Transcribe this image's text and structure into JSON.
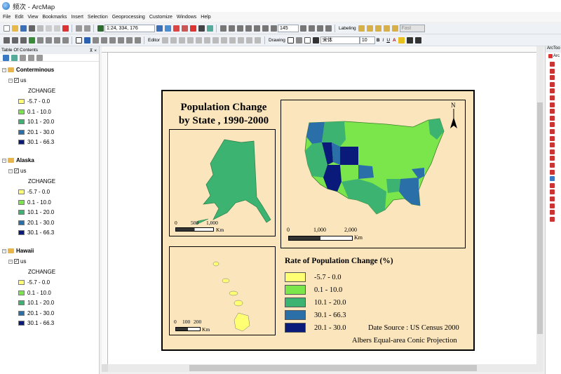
{
  "window": {
    "title": "频次 - ArcMap"
  },
  "menu": [
    "File",
    "Edit",
    "View",
    "Bookmarks",
    "Insert",
    "Selection",
    "Geoprocessing",
    "Customize",
    "Windows",
    "Help"
  ],
  "toolbar": {
    "scale": "1:24, 334, 176",
    "zoom": "145",
    "labeling": "Labeling",
    "fast": "Fast",
    "editor": "Editor",
    "drawing": "Drawing",
    "font": "宋体",
    "font_size": "10",
    "bold": "B",
    "italic": "I",
    "underline": "U",
    "font_color": "A"
  },
  "toc": {
    "title": "Table Of Contents",
    "pin": "⊼ ×",
    "groups": [
      {
        "frame": "Conterminous",
        "layer": "us",
        "field": "ZCHANGE"
      },
      {
        "frame": "Alaska",
        "layer": "us",
        "field": "ZCHANGE"
      },
      {
        "frame": "Hawaii",
        "layer": "us",
        "field": "ZCHANGE"
      }
    ],
    "classes": [
      {
        "label": "-5.7 - 0.0",
        "color": "#ffff73"
      },
      {
        "label": "0.1 - 10.0",
        "color": "#7ae64b"
      },
      {
        "label": "10.1 - 20.0",
        "color": "#3cb371"
      },
      {
        "label": "20.1 - 30.0",
        "color": "#2a6fa8"
      },
      {
        "label": "30.1 - 66.3",
        "color": "#0a1a7a"
      }
    ]
  },
  "right_panel": {
    "title": "ArcToo",
    "item": "Arc"
  },
  "map": {
    "title_line1": "Population Change",
    "title_line2": "by State , 1990-2000",
    "north": "N",
    "alaska_scale": {
      "labels": [
        "0",
        "500",
        "1,000"
      ],
      "unit": "Km"
    },
    "conus_scale": {
      "labels": [
        "0",
        "1,000",
        "2,000"
      ],
      "unit": "Km"
    },
    "hawaii_scale": {
      "labels": [
        "0",
        "100",
        "200"
      ],
      "unit": "Km"
    },
    "legend_title": "Rate of Population Change (%)",
    "legend": [
      {
        "label": "-5.7 - 0.0",
        "color": "#ffff73"
      },
      {
        "label": "0.1 - 10.0",
        "color": "#7ae64b"
      },
      {
        "label": "10.1 - 20.0",
        "color": "#3cb371"
      },
      {
        "label": "30.1 - 66.3",
        "color": "#2a6fa8"
      },
      {
        "label": "20.1 - 30.0",
        "color": "#0a1a7a"
      }
    ],
    "source": "Date Source : US Census 2000",
    "projection": "Albers Equal-area Conic Projection"
  }
}
